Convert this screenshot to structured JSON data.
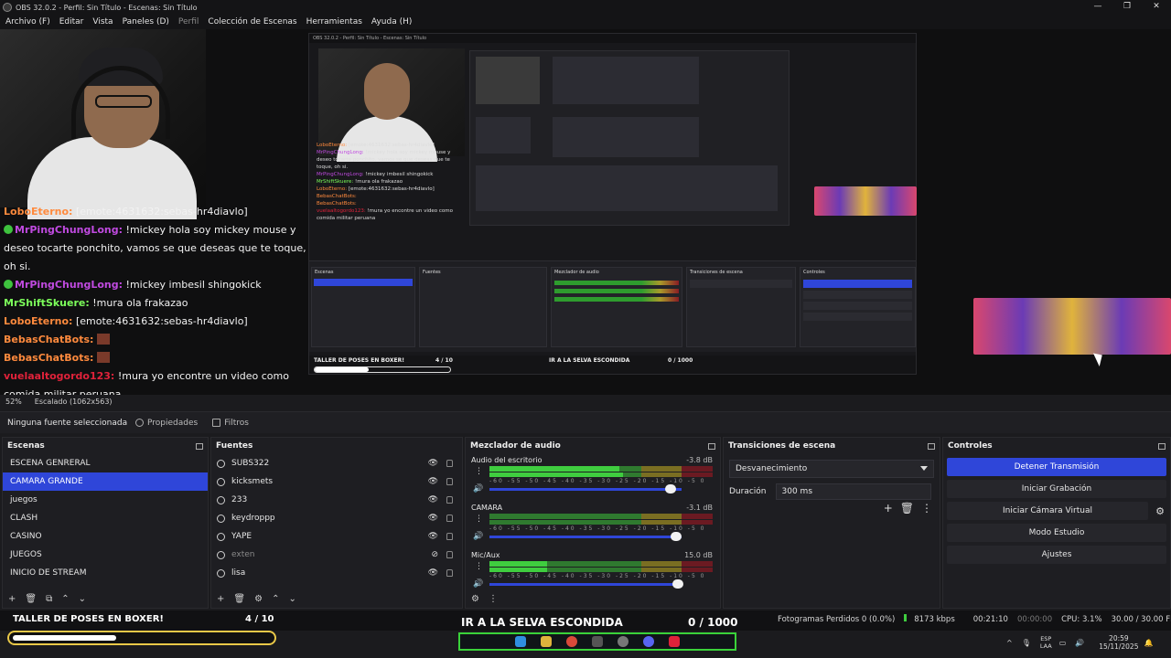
{
  "window": {
    "title": "OBS 32.0.2 - Perfil: Sin Título - Escenas: Sin Título",
    "min": "—",
    "max": "❐",
    "close": "✕"
  },
  "menu": [
    "Archivo (F)",
    "Editar",
    "Vista",
    "Paneles (D)",
    "Perfil",
    "Colección de Escenas",
    "Herramientas",
    "Ayuda (H)"
  ],
  "chat": [
    {
      "name": "LoboEterno:",
      "name_color": "#ff8a3d",
      "text": "[emote:4631632:sebas-hr4diavlo]"
    },
    {
      "name": "MrPingChungLong:",
      "name_color": "#c04ae0",
      "text": "!mickey hola soy mickey mouse y deseo tocarte ponchito, vamos se que deseas que te toque, oh si.",
      "badges": true
    },
    {
      "name": "MrPingChungLong:",
      "name_color": "#c04ae0",
      "text": "!mickey imbesil shingokick",
      "badges": true
    },
    {
      "name": "MrShiftSkuere:",
      "name_color": "#7cff5a",
      "text": "!mura ola frakazao"
    },
    {
      "name": "LoboEterno:",
      "name_color": "#ff8a3d",
      "text": "[emote:4631632:sebas-hr4diavlo]"
    },
    {
      "name": "BebasChatBots:",
      "name_color": "#ff8a3d",
      "text": "",
      "emote": true
    },
    {
      "name": "BebasChatBots:",
      "name_color": "#ff8a3d",
      "text": "",
      "emote": true
    },
    {
      "name": "vuelaaltogordo123:",
      "name_color": "#e0223a",
      "text": "!mura yo encontre un video como comida militar peruana"
    }
  ],
  "preview_status": {
    "zoom": "52%",
    "scale": "Escalado (1062x563)"
  },
  "nested": {
    "title": "OBS 32.0.2 - Perfil: Sin Título - Escenas: Sin Título",
    "docks": [
      "Escenas",
      "Fuentes",
      "Mezclador de audio",
      "Transiciones de escena",
      "Controles"
    ],
    "foot_taller": "TALLER DE POSES EN BOXER!",
    "foot_count": "4 / 10",
    "foot_selva": "IR A LA SELVA ESCONDIDA",
    "foot_selva_count": "0 / 1000",
    "progress": 0.4
  },
  "source_toolbar": {
    "label": "Ninguna fuente seleccionada",
    "properties": "Propiedades",
    "filters": "Filtros"
  },
  "scenes": {
    "title": "Escenas",
    "items": [
      "ESCENA GENRERAL",
      "CAMARA GRANDE",
      "juegos",
      "CLASH",
      "CASINO",
      "JUEGOS",
      "INICIO DE STREAM"
    ],
    "selected": 1,
    "footer": [
      "+",
      "🗑",
      "⧉",
      "⌃",
      "⌄"
    ]
  },
  "sources": {
    "title": "Fuentes",
    "items": [
      {
        "label": "SUBS322",
        "visible": true
      },
      {
        "label": "kicksmets",
        "visible": true
      },
      {
        "label": "233",
        "visible": true
      },
      {
        "label": "keydroppp",
        "visible": true
      },
      {
        "label": "YAPE",
        "visible": true
      },
      {
        "label": "exten",
        "visible": false
      },
      {
        "label": "lisa",
        "visible": true
      }
    ],
    "footer": [
      "+",
      "🗑",
      "⚙",
      "⌃",
      "⌄"
    ]
  },
  "mixer": {
    "title": "Mezclador de audio",
    "channels": [
      {
        "name": "Audio del escritorio",
        "db": "-3.8 dB",
        "level": 0.58,
        "level2": 0.6,
        "volume": 0.96
      },
      {
        "name": "CAMARA",
        "db": "-3.1 dB",
        "level": 0.0,
        "level2": 0.0,
        "volume": 0.99
      },
      {
        "name": "Mic/Aux",
        "db": "15.0 dB",
        "level": 0.26,
        "level2": 0.26,
        "volume": 1.0
      }
    ],
    "ticks": "-60 -55 -50 -45 -40 -35 -30 -25 -20 -15 -10 -5 0",
    "footer": [
      "⚙",
      "⋮"
    ]
  },
  "transitions": {
    "title": "Transiciones de escena",
    "selected": "Desvanecimiento",
    "duration_label": "Duración",
    "duration_value": "300 ms"
  },
  "controls": {
    "title": "Controles",
    "buttons": [
      "Detener Transmisión",
      "Iniciar Grabación",
      "Iniciar Cámara Virtual",
      "Modo Estudio",
      "Ajustes"
    ]
  },
  "overlay": {
    "taller": "TALLER DE POSES EN BOXER!",
    "taller_count": "4 / 10",
    "progress": 0.4,
    "selva": "IR A LA SELVA ESCONDIDA",
    "selva_count": "0 / 1000"
  },
  "status": {
    "dropped": "Fotogramas Perdidos 0 (0.0%)",
    "kbps": "8173 kbps",
    "live_time": "00:21:10",
    "rec_time": "00:00:00",
    "cpu": "CPU: 3.1%",
    "fps": "30.00 / 30.00 FPS"
  },
  "tray": {
    "lang1": "ESP",
    "lang2": "LAA",
    "time": "20:59",
    "date": "15/11/2025"
  },
  "colors": {
    "accent": "#2f46d9",
    "background": "#1e1e22",
    "live_green": "#3fcd3f"
  }
}
